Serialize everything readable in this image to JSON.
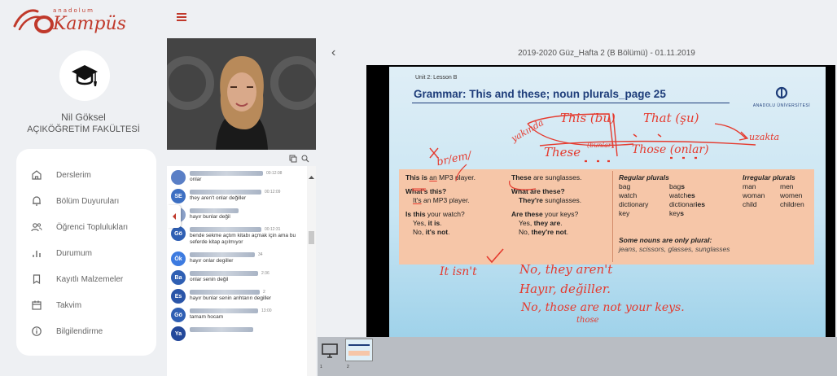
{
  "brand": {
    "small": "anadolum",
    "main": "Kampüs"
  },
  "user": {
    "name": "Nil Göksel",
    "faculty": "AÇIKÖĞRETİM FAKÜLTESİ"
  },
  "menu": [
    {
      "label": "Derslerim",
      "icon": "home-icon"
    },
    {
      "label": "Bölüm Duyuruları",
      "icon": "bell-icon"
    },
    {
      "label": "Öğrenci Toplulukları",
      "icon": "users-icon"
    },
    {
      "label": "Durumum",
      "icon": "bar-chart-icon"
    },
    {
      "label": "Kayıtlı Malzemeler",
      "icon": "bookmark-icon"
    },
    {
      "label": "Takvim",
      "icon": "calendar-icon"
    },
    {
      "label": "Bilgilendirme",
      "icon": "info-icon"
    }
  ],
  "presentation_title": "2019-2020 Güz_Hafta 2 (B Bölümü) - 01.11.2019",
  "chat": [
    {
      "initials": "",
      "time": "00:12:08",
      "text": "onlar"
    },
    {
      "initials": "SE",
      "time": "00:12:09",
      "text": "they aren't onlar değiller"
    },
    {
      "initials": "",
      "time": "",
      "text": "hayır bunlar değil"
    },
    {
      "initials": "Gö",
      "time": "00:12:31",
      "text": "bende sekme açtım kitabı açmak için ama bu seferde kitap açılmıyor"
    },
    {
      "initials": "Ök",
      "time": "34",
      "text": "hayır onlar degiller"
    },
    {
      "initials": "Ba",
      "time": "2:36",
      "text": "onlar senin değil"
    },
    {
      "initials": "Es",
      "time": "2",
      "text": "hayır bunlar senin anhtarın degiller"
    },
    {
      "initials": "Gö",
      "time": "13:00",
      "text": "tamam hocam"
    },
    {
      "initials": "Ya",
      "time": "",
      "text": ""
    }
  ],
  "slide": {
    "unit": "Unit 2: Lesson B",
    "title": "Grammar: This and these; noun plurals_page 25",
    "logo_text": "ANADOLU ÜNİVERSİTESİ",
    "col1": {
      "r1a": "This is ",
      "r1b": "an",
      "r1c": " MP3 player.",
      "r2": "What's this?",
      "r3a": "It's",
      "r3b": " an MP3 player.",
      "r4a": "Is this",
      "r4b": " your watch?",
      "r5a": "Yes, ",
      "r5b": "it is",
      "r5c": ".",
      "r6a": "No, ",
      "r6b": "it's not",
      "r6c": "."
    },
    "col2": {
      "r1a": "These",
      "r1b": " are sunglasses.",
      "r2": "What are these?",
      "r3a": "They're",
      "r3b": " sunglasses.",
      "r4a": "Are these",
      "r4b": " your keys?",
      "r5a": "Yes, ",
      "r5b": "they are",
      "r5c": ".",
      "r6a": "No, ",
      "r6b": "they're not",
      "r6c": "."
    },
    "regular_heading": "Regular plurals",
    "irregular_heading": "Irregular plurals",
    "regular": [
      [
        "bag",
        "bag",
        "s"
      ],
      [
        "watch",
        "watch",
        "es"
      ],
      [
        "dictionary",
        "dictionar",
        "ies"
      ],
      [
        "key",
        "key",
        "s"
      ]
    ],
    "irregular": [
      [
        "man",
        "men"
      ],
      [
        "woman",
        "women"
      ],
      [
        "child",
        "children"
      ]
    ],
    "only_plural_heading": "Some nouns are only plural:",
    "only_plural": "jeans, scissors, glasses, sunglasses"
  },
  "annotations": {
    "this": "This (bu)",
    "that": "That (şu)",
    "these": "These",
    "bunlar": "(bunlar)",
    "those": "Those (onlar)",
    "yakinda": "yakında",
    "uzakta": "uzakta",
    "brlem": "br/em/",
    "it_isnt": "It isn't",
    "no_they_arent": "No, they aren't",
    "hayir": "Hayır, değiller.",
    "no_those": "No, those are not your keys.",
    "those_small": "those"
  },
  "thumbs": {
    "first": "1",
    "second": "2"
  },
  "colors": {
    "brand": "#c0392b",
    "slide_title": "#1e3d7a",
    "ink": "#e53a2e"
  }
}
